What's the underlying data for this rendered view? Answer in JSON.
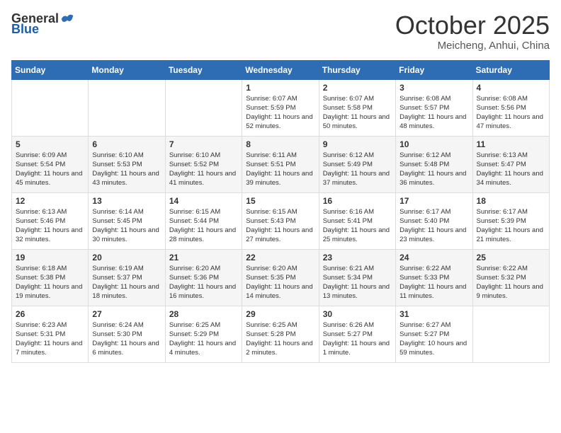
{
  "header": {
    "logo_general": "General",
    "logo_blue": "Blue",
    "month": "October 2025",
    "location": "Meicheng, Anhui, China"
  },
  "weekdays": [
    "Sunday",
    "Monday",
    "Tuesday",
    "Wednesday",
    "Thursday",
    "Friday",
    "Saturday"
  ],
  "weeks": [
    [
      {
        "day": "",
        "info": ""
      },
      {
        "day": "",
        "info": ""
      },
      {
        "day": "",
        "info": ""
      },
      {
        "day": "1",
        "info": "Sunrise: 6:07 AM\nSunset: 5:59 PM\nDaylight: 11 hours and 52 minutes."
      },
      {
        "day": "2",
        "info": "Sunrise: 6:07 AM\nSunset: 5:58 PM\nDaylight: 11 hours and 50 minutes."
      },
      {
        "day": "3",
        "info": "Sunrise: 6:08 AM\nSunset: 5:57 PM\nDaylight: 11 hours and 48 minutes."
      },
      {
        "day": "4",
        "info": "Sunrise: 6:08 AM\nSunset: 5:56 PM\nDaylight: 11 hours and 47 minutes."
      }
    ],
    [
      {
        "day": "5",
        "info": "Sunrise: 6:09 AM\nSunset: 5:54 PM\nDaylight: 11 hours and 45 minutes."
      },
      {
        "day": "6",
        "info": "Sunrise: 6:10 AM\nSunset: 5:53 PM\nDaylight: 11 hours and 43 minutes."
      },
      {
        "day": "7",
        "info": "Sunrise: 6:10 AM\nSunset: 5:52 PM\nDaylight: 11 hours and 41 minutes."
      },
      {
        "day": "8",
        "info": "Sunrise: 6:11 AM\nSunset: 5:51 PM\nDaylight: 11 hours and 39 minutes."
      },
      {
        "day": "9",
        "info": "Sunrise: 6:12 AM\nSunset: 5:49 PM\nDaylight: 11 hours and 37 minutes."
      },
      {
        "day": "10",
        "info": "Sunrise: 6:12 AM\nSunset: 5:48 PM\nDaylight: 11 hours and 36 minutes."
      },
      {
        "day": "11",
        "info": "Sunrise: 6:13 AM\nSunset: 5:47 PM\nDaylight: 11 hours and 34 minutes."
      }
    ],
    [
      {
        "day": "12",
        "info": "Sunrise: 6:13 AM\nSunset: 5:46 PM\nDaylight: 11 hours and 32 minutes."
      },
      {
        "day": "13",
        "info": "Sunrise: 6:14 AM\nSunset: 5:45 PM\nDaylight: 11 hours and 30 minutes."
      },
      {
        "day": "14",
        "info": "Sunrise: 6:15 AM\nSunset: 5:44 PM\nDaylight: 11 hours and 28 minutes."
      },
      {
        "day": "15",
        "info": "Sunrise: 6:15 AM\nSunset: 5:43 PM\nDaylight: 11 hours and 27 minutes."
      },
      {
        "day": "16",
        "info": "Sunrise: 6:16 AM\nSunset: 5:41 PM\nDaylight: 11 hours and 25 minutes."
      },
      {
        "day": "17",
        "info": "Sunrise: 6:17 AM\nSunset: 5:40 PM\nDaylight: 11 hours and 23 minutes."
      },
      {
        "day": "18",
        "info": "Sunrise: 6:17 AM\nSunset: 5:39 PM\nDaylight: 11 hours and 21 minutes."
      }
    ],
    [
      {
        "day": "19",
        "info": "Sunrise: 6:18 AM\nSunset: 5:38 PM\nDaylight: 11 hours and 19 minutes."
      },
      {
        "day": "20",
        "info": "Sunrise: 6:19 AM\nSunset: 5:37 PM\nDaylight: 11 hours and 18 minutes."
      },
      {
        "day": "21",
        "info": "Sunrise: 6:20 AM\nSunset: 5:36 PM\nDaylight: 11 hours and 16 minutes."
      },
      {
        "day": "22",
        "info": "Sunrise: 6:20 AM\nSunset: 5:35 PM\nDaylight: 11 hours and 14 minutes."
      },
      {
        "day": "23",
        "info": "Sunrise: 6:21 AM\nSunset: 5:34 PM\nDaylight: 11 hours and 13 minutes."
      },
      {
        "day": "24",
        "info": "Sunrise: 6:22 AM\nSunset: 5:33 PM\nDaylight: 11 hours and 11 minutes."
      },
      {
        "day": "25",
        "info": "Sunrise: 6:22 AM\nSunset: 5:32 PM\nDaylight: 11 hours and 9 minutes."
      }
    ],
    [
      {
        "day": "26",
        "info": "Sunrise: 6:23 AM\nSunset: 5:31 PM\nDaylight: 11 hours and 7 minutes."
      },
      {
        "day": "27",
        "info": "Sunrise: 6:24 AM\nSunset: 5:30 PM\nDaylight: 11 hours and 6 minutes."
      },
      {
        "day": "28",
        "info": "Sunrise: 6:25 AM\nSunset: 5:29 PM\nDaylight: 11 hours and 4 minutes."
      },
      {
        "day": "29",
        "info": "Sunrise: 6:25 AM\nSunset: 5:28 PM\nDaylight: 11 hours and 2 minutes."
      },
      {
        "day": "30",
        "info": "Sunrise: 6:26 AM\nSunset: 5:27 PM\nDaylight: 11 hours and 1 minute."
      },
      {
        "day": "31",
        "info": "Sunrise: 6:27 AM\nSunset: 5:27 PM\nDaylight: 10 hours and 59 minutes."
      },
      {
        "day": "",
        "info": ""
      }
    ]
  ]
}
